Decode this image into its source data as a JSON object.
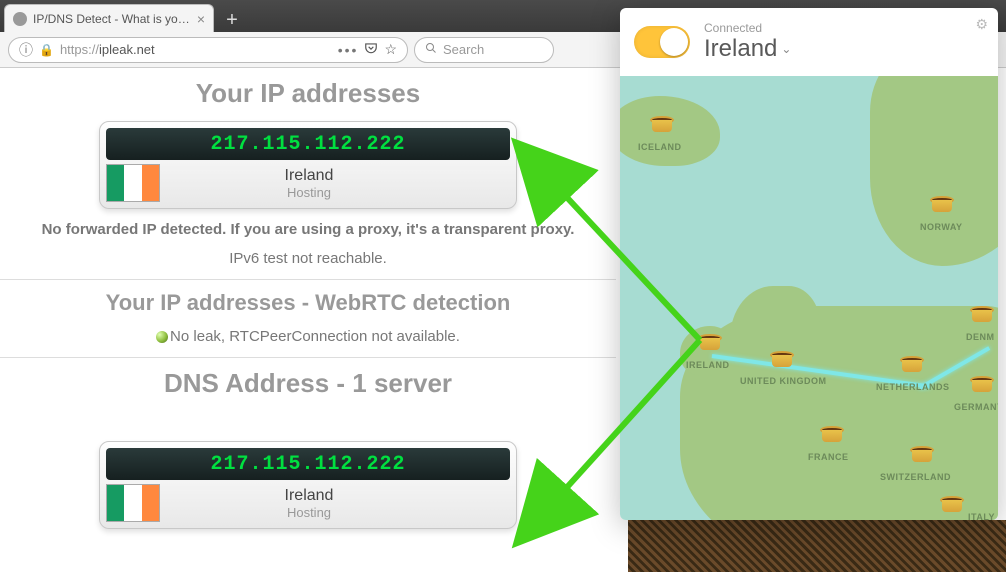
{
  "browser": {
    "tab_title": "IP/DNS Detect - What is your IP",
    "url_protocol": "https://",
    "url_host": "ipleak.net",
    "search_placeholder": "Search"
  },
  "page": {
    "heading_ip": "Your IP addresses",
    "ip_card": {
      "ip": "217.115.112.222",
      "country": "Ireland",
      "subtitle": "Hosting"
    },
    "forward_note": "No forwarded IP detected. If you are using a proxy, it's a transparent proxy.",
    "ipv6_note": "IPv6 test not reachable.",
    "heading_webrtc": "Your IP addresses - WebRTC detection",
    "webrtc_status": "No leak, RTCPeerConnection not available.",
    "heading_dns": "DNS Address - 1 server",
    "dns_card": {
      "ip": "217.115.112.222",
      "country": "Ireland",
      "subtitle": "Hosting"
    }
  },
  "vpn": {
    "status_label": "Connected",
    "location": "Ireland",
    "map_labels": {
      "iceland": "ICELAND",
      "norway": "NORWAY",
      "ireland": "IRELAND",
      "uk": "UNITED KINGDOM",
      "denmark": "DENM",
      "netherlands": "NETHERLANDS",
      "germany": "GERMANY",
      "france": "FRANCE",
      "switzerland": "SWITZERLAND",
      "italy": "ITALY"
    }
  }
}
